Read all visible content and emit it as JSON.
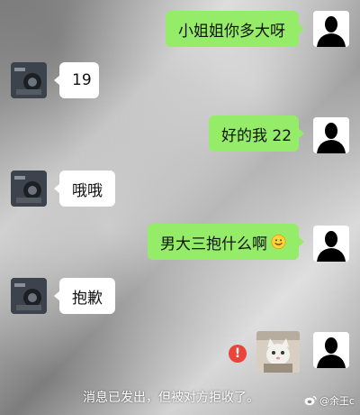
{
  "messages": [
    {
      "side": "me",
      "text": "小姐姐你多大呀"
    },
    {
      "side": "other",
      "text": "19"
    },
    {
      "side": "me",
      "text": "好的我 22"
    },
    {
      "side": "other",
      "text": "哦哦"
    },
    {
      "side": "me",
      "text": "男大三抱什么啊",
      "emoji": "smiley-emoji"
    },
    {
      "side": "other",
      "text": "抱歉"
    },
    {
      "side": "me",
      "type": "image",
      "status": "failed"
    }
  ],
  "system_notice": "消息已发出，但被对方拒收了。",
  "watermark": "@余王c",
  "icons": {
    "me_avatar": "silhouette-avatar",
    "other_avatar": "photo-avatar",
    "error": "exclamation-circle-icon",
    "weibo": "weibo-logo-icon"
  },
  "colors": {
    "my_bubble": "#95ec69",
    "other_bubble": "#ffffff",
    "error": "#e8453c"
  }
}
